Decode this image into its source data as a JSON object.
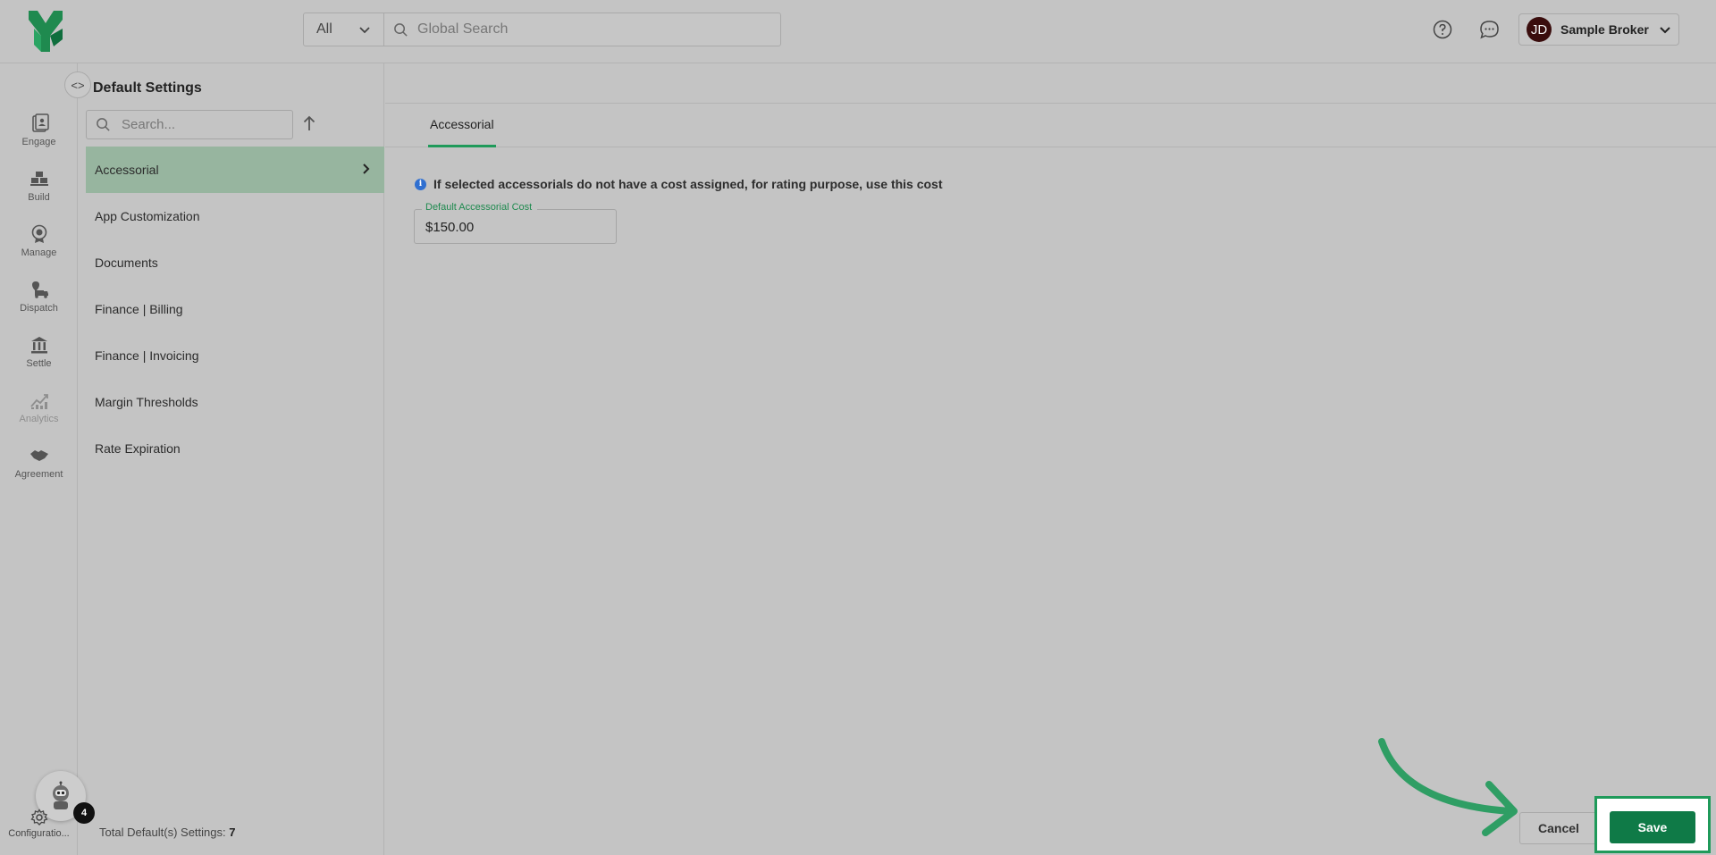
{
  "topbar": {
    "logo": "brand-logo",
    "scope_label": "All",
    "search_placeholder": "Global Search",
    "user_initials": "JD",
    "user_name": "Sample Broker"
  },
  "rail": {
    "items": [
      {
        "label": "Engage",
        "icon": "engage-icon"
      },
      {
        "label": "Build",
        "icon": "build-icon"
      },
      {
        "label": "Manage",
        "icon": "manage-icon"
      },
      {
        "label": "Dispatch",
        "icon": "dispatch-icon"
      },
      {
        "label": "Settle",
        "icon": "settle-icon"
      },
      {
        "label": "Analytics",
        "icon": "analytics-icon"
      },
      {
        "label": "Agreement",
        "icon": "agreement-icon"
      }
    ],
    "bot_badge": "4",
    "config_label": "Configuratio..."
  },
  "settings": {
    "title": "Default Settings",
    "search_placeholder": "Search...",
    "items": [
      {
        "label": "Accessorial",
        "active": true
      },
      {
        "label": "App Customization"
      },
      {
        "label": "Documents"
      },
      {
        "label": "Finance | Billing"
      },
      {
        "label": "Finance | Invoicing"
      },
      {
        "label": "Margin Thresholds"
      },
      {
        "label": "Rate Expiration"
      }
    ],
    "total_label": "Total Default(s) Settings:",
    "total_count": "7"
  },
  "main": {
    "tab_label": "Accessorial",
    "info_text": "If selected accessorials do not have a cost assigned, for rating purpose, use this cost",
    "field_label": "Default Accessorial Cost",
    "field_value": "$150.00"
  },
  "footer": {
    "cancel_label": "Cancel",
    "save_label": "Save"
  },
  "colors": {
    "accent": "#1f9a5a",
    "save_button": "#0f7a47",
    "active_item": "#97b59f",
    "info": "#2f6fd0"
  }
}
